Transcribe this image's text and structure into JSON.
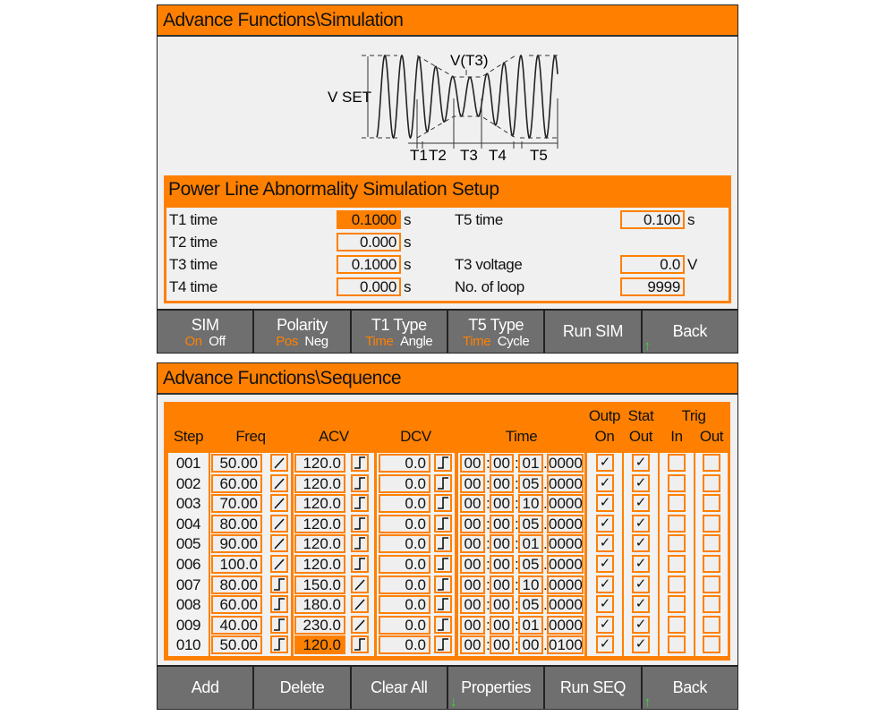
{
  "colors": {
    "accent": "#ff8000",
    "softkey": "#6f6f6f",
    "panel": "#f0f0f0",
    "indicator_arrow": "#2ee02e"
  },
  "simulation": {
    "title": "Advance Functions\\Simulation",
    "diagram": {
      "vset": "V SET",
      "vt3": "V(T3)",
      "t1": "T1",
      "t2": "T2",
      "t3": "T3",
      "t4": "T4",
      "t5": "T5"
    },
    "setup_title": "Power Line Abnormality Simulation Setup",
    "fields": {
      "t1": {
        "label": "T1 time",
        "value": "0.1000",
        "unit": "s",
        "selected": true
      },
      "t2": {
        "label": "T2 time",
        "value": "0.000",
        "unit": "s"
      },
      "t3": {
        "label": "T3 time",
        "value": "0.1000",
        "unit": "s"
      },
      "t4": {
        "label": "T4 time",
        "value": "0.000",
        "unit": "s"
      },
      "t5": {
        "label": "T5 time",
        "value": "0.100",
        "unit": "s"
      },
      "t3v": {
        "label": "T3 voltage",
        "value": "0.0",
        "unit": "V"
      },
      "loop": {
        "label": "No. of loop",
        "value": "9999"
      }
    },
    "softkeys": {
      "sim": {
        "label": "SIM",
        "opt1": "On",
        "opt2": "Off"
      },
      "polarity": {
        "label": "Polarity",
        "opt1": "Pos",
        "opt2": "Neg"
      },
      "t1type": {
        "label": "T1 Type",
        "opt1": "Time",
        "opt2": "Angle"
      },
      "t5type": {
        "label": "T5 Type",
        "opt1": "Time",
        "opt2": "Cycle"
      },
      "run": {
        "label": "Run SIM"
      },
      "back": {
        "label": "Back",
        "arrow": "↑"
      }
    }
  },
  "sequence": {
    "title": "Advance Functions\\Sequence",
    "headers": {
      "step": "Step",
      "freq": "Freq",
      "acv": "ACV",
      "dcv": "DCV",
      "time": "Time",
      "outp": "Outp",
      "stat": "Stat",
      "on": "On",
      "out": "Out",
      "trig": "Trig",
      "in": "In",
      "tout": "Out"
    },
    "rows": [
      {
        "step": "001",
        "freq": "50.00",
        "freq_mode": "ramp",
        "acv": "120.0",
        "acv_mode": "step",
        "dcv": "0.0",
        "dcv_mode": "step",
        "h": "00",
        "m": "00",
        "s": "01",
        "f": "0000",
        "outp_on": true,
        "stat_out": true,
        "trig_in": false,
        "trig_out": false
      },
      {
        "step": "002",
        "freq": "60.00",
        "freq_mode": "ramp",
        "acv": "120.0",
        "acv_mode": "step",
        "dcv": "0.0",
        "dcv_mode": "step",
        "h": "00",
        "m": "00",
        "s": "05",
        "f": "0000",
        "outp_on": true,
        "stat_out": true,
        "trig_in": false,
        "trig_out": false
      },
      {
        "step": "003",
        "freq": "70.00",
        "freq_mode": "ramp",
        "acv": "120.0",
        "acv_mode": "step",
        "dcv": "0.0",
        "dcv_mode": "step",
        "h": "00",
        "m": "00",
        "s": "10",
        "f": "0000",
        "outp_on": true,
        "stat_out": true,
        "trig_in": false,
        "trig_out": false
      },
      {
        "step": "004",
        "freq": "80.00",
        "freq_mode": "ramp",
        "acv": "120.0",
        "acv_mode": "step",
        "dcv": "0.0",
        "dcv_mode": "step",
        "h": "00",
        "m": "00",
        "s": "05",
        "f": "0000",
        "outp_on": true,
        "stat_out": true,
        "trig_in": false,
        "trig_out": false
      },
      {
        "step": "005",
        "freq": "90.00",
        "freq_mode": "ramp",
        "acv": "120.0",
        "acv_mode": "step",
        "dcv": "0.0",
        "dcv_mode": "step",
        "h": "00",
        "m": "00",
        "s": "01",
        "f": "0000",
        "outp_on": true,
        "stat_out": true,
        "trig_in": false,
        "trig_out": false
      },
      {
        "step": "006",
        "freq": "100.0",
        "freq_mode": "ramp",
        "acv": "120.0",
        "acv_mode": "step",
        "dcv": "0.0",
        "dcv_mode": "step",
        "h": "00",
        "m": "00",
        "s": "05",
        "f": "0000",
        "outp_on": true,
        "stat_out": true,
        "trig_in": false,
        "trig_out": false
      },
      {
        "step": "007",
        "freq": "80.00",
        "freq_mode": "step",
        "acv": "150.0",
        "acv_mode": "ramp",
        "dcv": "0.0",
        "dcv_mode": "step",
        "h": "00",
        "m": "00",
        "s": "10",
        "f": "0000",
        "outp_on": true,
        "stat_out": true,
        "trig_in": false,
        "trig_out": false
      },
      {
        "step": "008",
        "freq": "60.00",
        "freq_mode": "step",
        "acv": "180.0",
        "acv_mode": "ramp",
        "dcv": "0.0",
        "dcv_mode": "step",
        "h": "00",
        "m": "00",
        "s": "05",
        "f": "0000",
        "outp_on": true,
        "stat_out": true,
        "trig_in": false,
        "trig_out": false
      },
      {
        "step": "009",
        "freq": "40.00",
        "freq_mode": "step",
        "acv": "230.0",
        "acv_mode": "ramp",
        "dcv": "0.0",
        "dcv_mode": "step",
        "h": "00",
        "m": "00",
        "s": "01",
        "f": "0000",
        "outp_on": true,
        "stat_out": true,
        "trig_in": false,
        "trig_out": false
      },
      {
        "step": "010",
        "freq": "50.00",
        "freq_mode": "step",
        "acv": "120.0",
        "acv_mode": "step",
        "acv_selected": true,
        "dcv": "0.0",
        "dcv_mode": "step",
        "h": "00",
        "m": "00",
        "s": "00",
        "f": "0100",
        "outp_on": true,
        "stat_out": true,
        "trig_in": false,
        "trig_out": false
      }
    ],
    "softkeys": {
      "add": "Add",
      "delete": "Delete",
      "clear": "Clear All",
      "properties": "Properties",
      "properties_arrow": "↓",
      "run": "Run SEQ",
      "back": "Back",
      "back_arrow": "↑"
    }
  }
}
